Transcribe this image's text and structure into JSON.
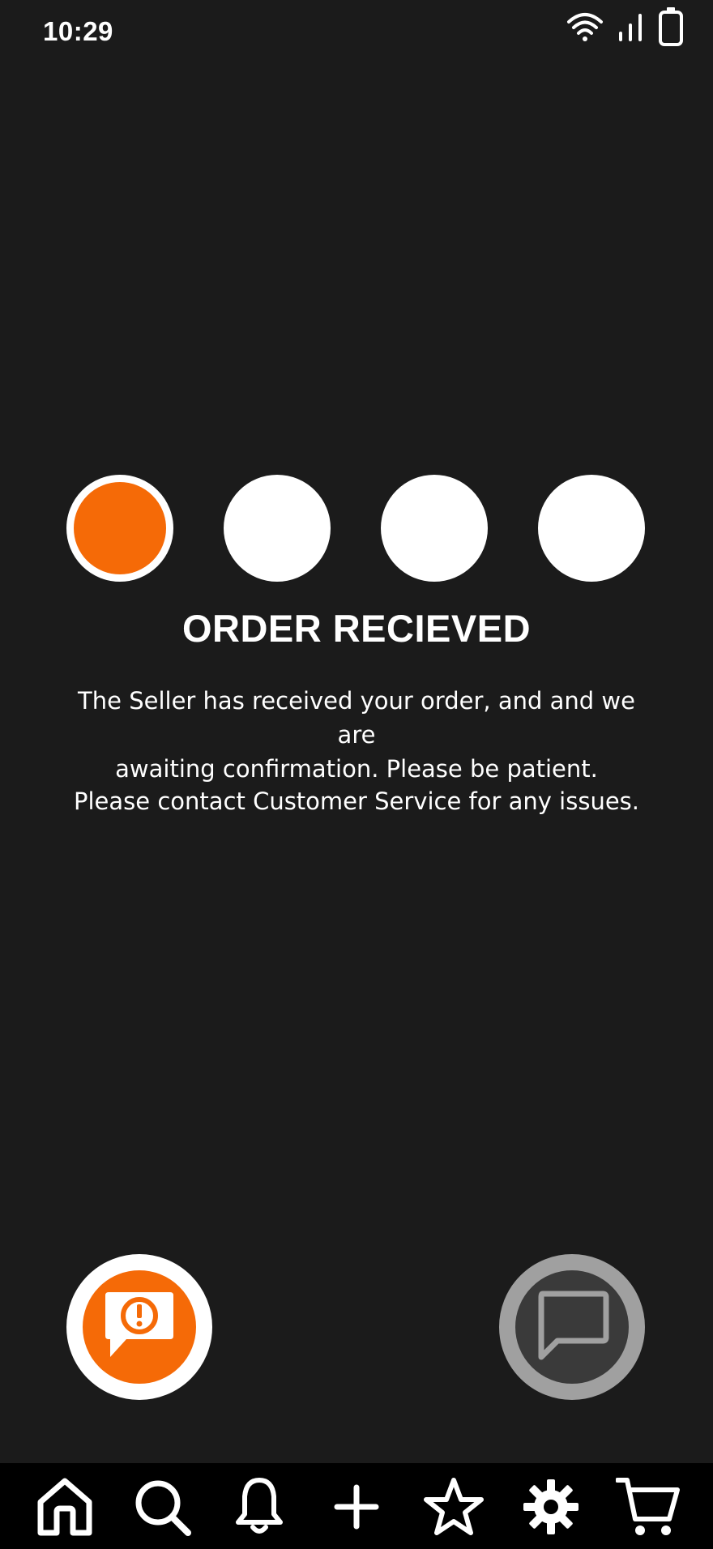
{
  "status_bar": {
    "time": "10:29",
    "icons": [
      "wifi-icon",
      "signal-icon",
      "battery-icon"
    ]
  },
  "progress": {
    "total_steps": 4,
    "current_step": 1,
    "active_color": "#f56a07",
    "inactive_color": "#ffffff"
  },
  "order_status": {
    "title": "ORDER RECIEVED",
    "message_line1": "The Seller has received your order, and and we are",
    "message_line2": "awaiting confirmation. Please be patient.",
    "contact_note": "Please contact Customer Service for any issues."
  },
  "actions": {
    "report_icon": "report-issue-icon",
    "chat_icon": "chat-icon",
    "accent_color": "#f56a07"
  },
  "bottom_nav": {
    "items": [
      "home-icon",
      "search-icon",
      "notifications-icon",
      "add-icon",
      "favorites-icon",
      "settings-icon",
      "cart-icon"
    ]
  }
}
